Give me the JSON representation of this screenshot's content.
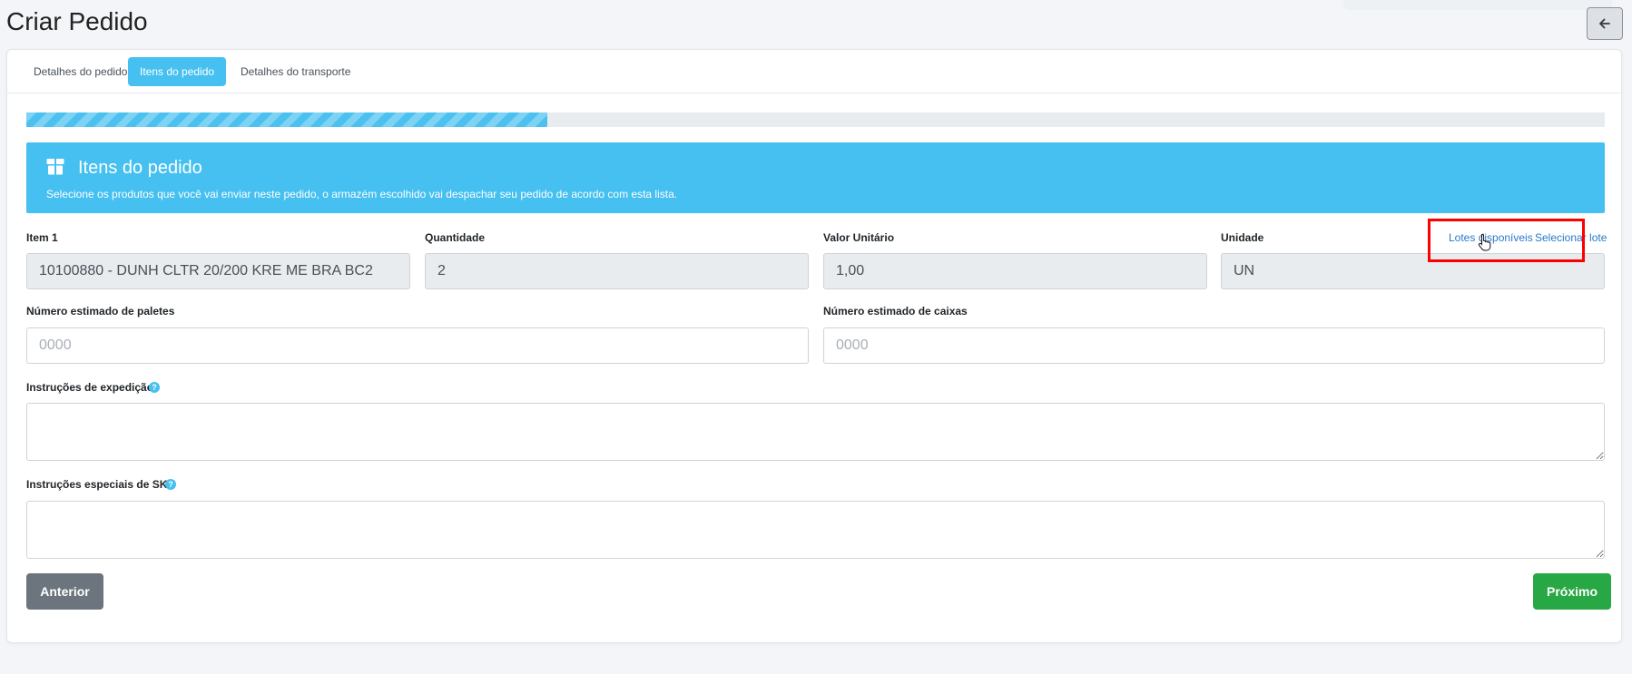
{
  "page": {
    "title": "Criar Pedido"
  },
  "header": {
    "back_icon": "arrow-left-icon"
  },
  "tabs": [
    {
      "label": "Detalhes do pedido",
      "active": false
    },
    {
      "label": "Itens do pedido",
      "active": true
    },
    {
      "label": "Detalhes do transporte",
      "active": false
    }
  ],
  "progress": {
    "percent": 33
  },
  "banner": {
    "icon": "box-icon",
    "title": "Itens do pedido",
    "subtitle": "Selecione os produtos que você vai enviar neste pedido, o armazém escolhido vai despachar seu pedido de acordo com esta lista."
  },
  "item": {
    "item_label": "Item 1",
    "item_value": "10100880 - DUNH CLTR 20/200 KRE ME BRA BC2",
    "quantity_label": "Quantidade",
    "quantity_value": "2",
    "unit_price_label": "Valor Unitário",
    "unit_price_value": "1,00",
    "unit_label": "Unidade",
    "unit_value": "UN",
    "lots_available_link": "Lotes disponíveis",
    "select_lot_link": "Selecionar lote"
  },
  "estimates": {
    "pallets_label": "Número estimado de paletes",
    "pallets_placeholder": "0000",
    "boxes_label": "Número estimado de caixas",
    "boxes_placeholder": "0000"
  },
  "instructions": {
    "shipping_label": "Instruções de expedição",
    "sku_label": "Instruções especiais de SKU",
    "help_glyph": "?"
  },
  "buttons": {
    "previous": "Anterior",
    "next": "Próximo"
  },
  "colors": {
    "accent": "#45c0f0",
    "link": "#2a78c8",
    "previous": "#6c757d",
    "next": "#28a745",
    "highlight": "#ff0000"
  }
}
